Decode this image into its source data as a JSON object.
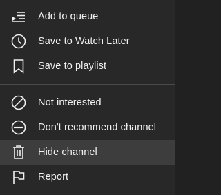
{
  "menu": {
    "group1": [
      {
        "label": "Add to queue",
        "icon": "add-to-queue-icon"
      },
      {
        "label": "Save to Watch Later",
        "icon": "clock-icon"
      },
      {
        "label": "Save to playlist",
        "icon": "bookmark-icon"
      }
    ],
    "group2": [
      {
        "label": "Not interested",
        "icon": "block-icon"
      },
      {
        "label": "Don't recommend channel",
        "icon": "remove-circle-icon"
      },
      {
        "label": "Hide channel",
        "icon": "trash-icon",
        "highlighted": true
      },
      {
        "label": "Report",
        "icon": "flag-icon"
      }
    ]
  },
  "colors": {
    "background": "#282828",
    "highlight": "#3d3d3d",
    "text": "#f1f1f1",
    "divider": "#4a4a4a"
  }
}
